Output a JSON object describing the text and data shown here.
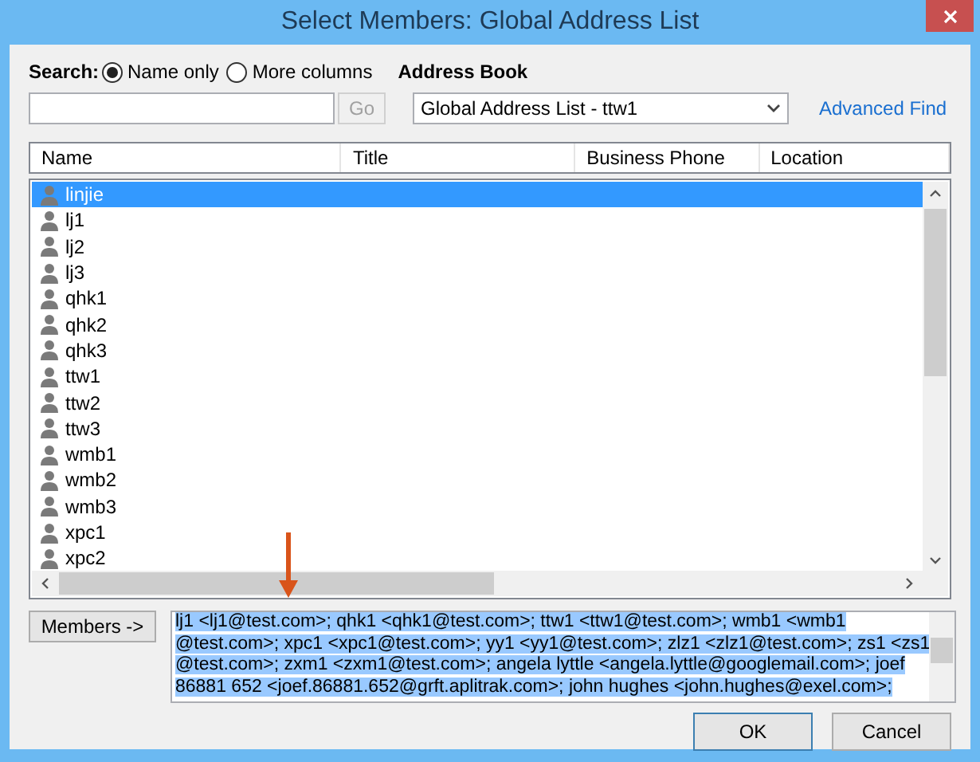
{
  "window": {
    "title": "Select Members: Global Address List"
  },
  "search": {
    "label": "Search:",
    "options": [
      {
        "label": "Name only",
        "selected": true
      },
      {
        "label": "More columns",
        "selected": false
      }
    ],
    "go_button": "Go",
    "go_disabled": true
  },
  "address_book": {
    "label": "Address Book",
    "value": "Global Address List - ttw1",
    "advanced_find": "Advanced Find"
  },
  "table": {
    "columns": [
      "Name",
      "Title",
      "Business Phone",
      "Location"
    ],
    "rows": [
      {
        "name": "linjie",
        "selected": true
      },
      {
        "name": "lj1",
        "selected": false
      },
      {
        "name": "lj2",
        "selected": false
      },
      {
        "name": "lj3",
        "selected": false
      },
      {
        "name": "qhk1",
        "selected": false
      },
      {
        "name": "qhk2",
        "selected": false
      },
      {
        "name": "qhk3",
        "selected": false
      },
      {
        "name": "ttw1",
        "selected": false
      },
      {
        "name": "ttw2",
        "selected": false
      },
      {
        "name": "ttw3",
        "selected": false
      },
      {
        "name": "wmb1",
        "selected": false
      },
      {
        "name": "wmb2",
        "selected": false
      },
      {
        "name": "wmb3",
        "selected": false
      },
      {
        "name": "xpc1",
        "selected": false
      },
      {
        "name": "xpc2",
        "selected": false
      }
    ]
  },
  "members": {
    "button": "Members ->",
    "selected": true,
    "lines": [
      "lj1 <lj1@test.com>; qhk1 <qhk1@test.com>; ttw1 <ttw1@test.com>; wmb1 <wmb1",
      "@test.com>; xpc1 <xpc1@test.com>; yy1 <yy1@test.com>; zlz1 <zlz1@test.com>; zs1 <zs1",
      "@test.com>; zxm1 <zxm1@test.com>; angela lyttle <angela.lyttle@googlemail.com>; joef",
      "86881 652 <joef.86881.652@grft.aplitrak.com>; john hughes <john.hughes@exel.com>;"
    ]
  },
  "buttons": [
    {
      "label": "OK",
      "default": true
    },
    {
      "label": "Cancel",
      "default": false
    }
  ]
}
